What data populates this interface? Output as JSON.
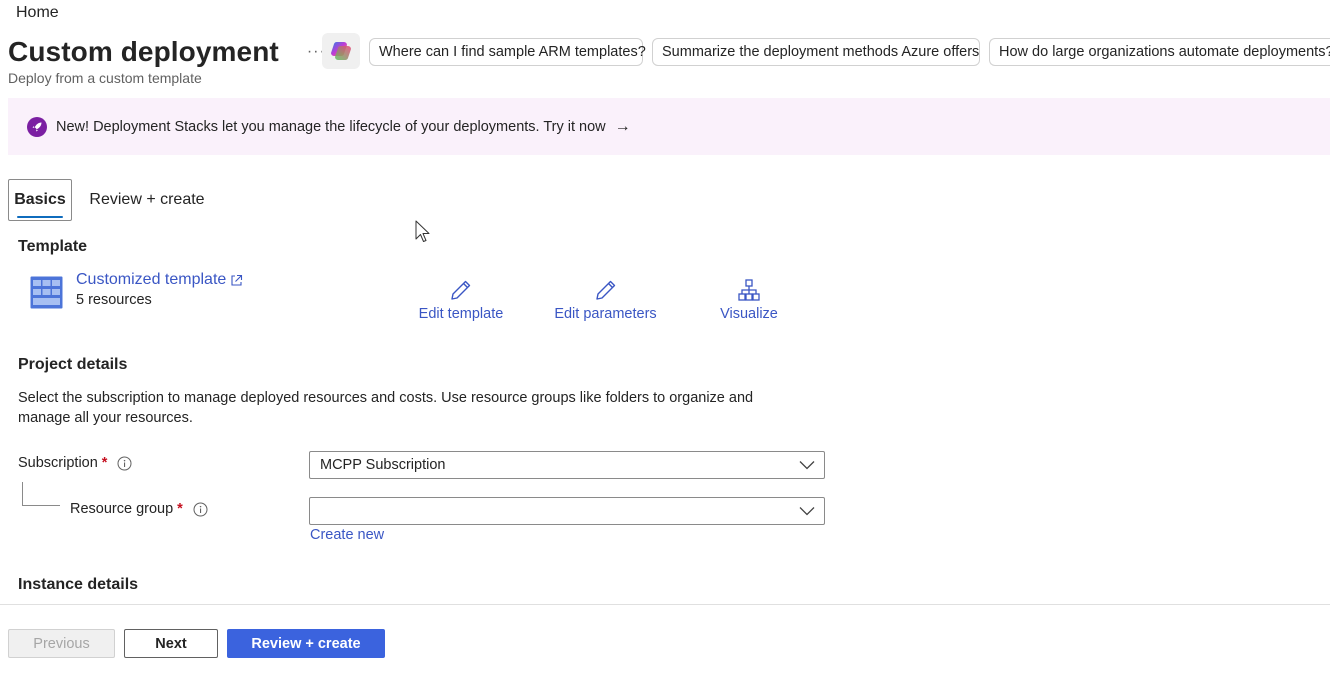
{
  "breadcrumb": {
    "home": "Home"
  },
  "header": {
    "title": "Custom deployment",
    "subtitle": "Deploy from a custom template",
    "more": "···",
    "suggestions": [
      "Where can I find sample ARM templates?",
      "Summarize the deployment methods Azure offers",
      "How do large organizations automate deployments?"
    ]
  },
  "banner": {
    "text": "New! Deployment Stacks let you manage the lifecycle of your deployments. Try it now",
    "arrow": "→",
    "icon": "rocket-icon",
    "color": "#7b1fa2"
  },
  "tabs": [
    {
      "label": "Basics",
      "active": true
    },
    {
      "label": "Review + create",
      "active": false
    }
  ],
  "template": {
    "heading": "Template",
    "link": "Customized template",
    "resources": "5 resources",
    "actions": [
      {
        "label": "Edit template",
        "icon": "pencil-icon"
      },
      {
        "label": "Edit parameters",
        "icon": "pencil-icon"
      },
      {
        "label": "Visualize",
        "icon": "hierarchy-icon"
      }
    ]
  },
  "project": {
    "heading": "Project details",
    "description": "Select the subscription to manage deployed resources and costs. Use resource groups like folders to organize and manage all your resources.",
    "subscription_label": "Subscription",
    "subscription_value": "MCPP Subscription",
    "resource_group_label": "Resource group",
    "resource_group_value": "",
    "required_mark": "*",
    "create_new": "Create new"
  },
  "instance": {
    "heading": "Instance details"
  },
  "footer": {
    "previous": "Previous",
    "next": "Next",
    "review": "Review + create"
  },
  "colors": {
    "accent": "#3b63de",
    "link": "#3a56c4",
    "required": "#c50f1f",
    "banner_bg": "#faf1fb"
  }
}
